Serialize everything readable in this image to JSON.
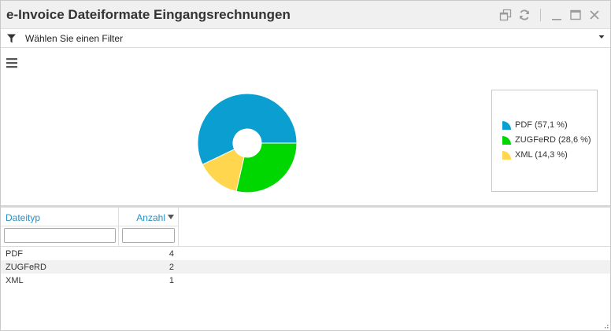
{
  "window": {
    "title": "e-Invoice Dateiformate Eingangsrechnungen"
  },
  "filter": {
    "label": "Wählen Sie einen Filter"
  },
  "colors": {
    "pdf": "#0a9fd0",
    "zugferd": "#00d600",
    "xml": "#ffd64d",
    "header_link": "#2a8fc2"
  },
  "chart_data": {
    "type": "pie",
    "donut": true,
    "legend_placement": "right",
    "categories": [
      "PDF",
      "ZUGFeRD",
      "XML"
    ],
    "values": [
      4,
      2,
      1
    ],
    "legend": [
      {
        "label": "PDF (57,1 %)",
        "color": "#0a9fd0"
      },
      {
        "label": "ZUGFeRD (28,6 %)",
        "color": "#00d600"
      },
      {
        "label": "XML (14,3 %)",
        "color": "#ffd64d"
      }
    ]
  },
  "grid": {
    "columns": [
      {
        "label": "Dateityp"
      },
      {
        "label": "Anzahl",
        "sorted": "desc"
      }
    ],
    "rows": [
      {
        "type": "PDF",
        "count": "4"
      },
      {
        "type": "ZUGFeRD",
        "count": "2"
      },
      {
        "type": "XML",
        "count": "1"
      }
    ]
  }
}
